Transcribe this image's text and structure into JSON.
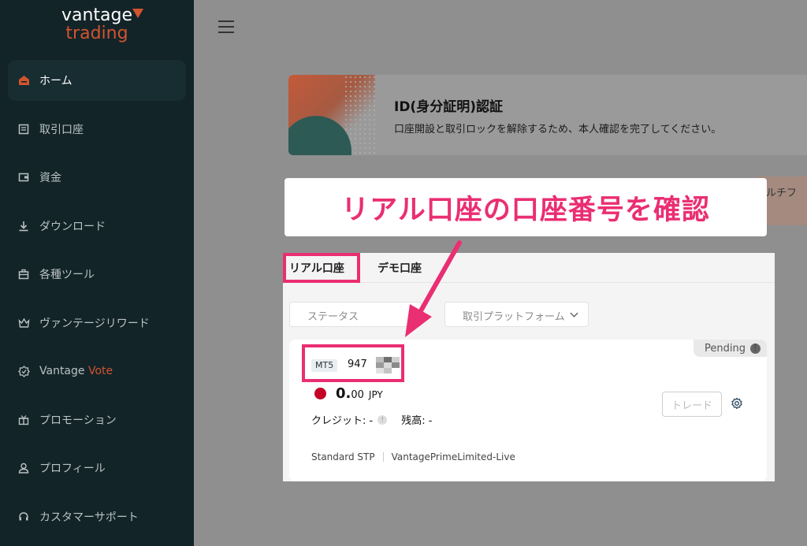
{
  "brand": {
    "line1": "vantage",
    "line2": "trading",
    "accent": "#d1542f"
  },
  "sidebar": {
    "items": [
      {
        "label": "ホーム",
        "icon": "home-icon",
        "active": true
      },
      {
        "label": "取引口座",
        "icon": "document-icon"
      },
      {
        "label": "資金",
        "icon": "wallet-icon"
      },
      {
        "label": "ダウンロード",
        "icon": "download-icon"
      },
      {
        "label": "各種ツール",
        "icon": "toolbox-icon"
      },
      {
        "label": "ヴァンテージリワード",
        "icon": "crown-icon"
      },
      {
        "label": "Vantage ",
        "label_accent": "Vote",
        "icon": "badge-icon"
      },
      {
        "label": "プロモーション",
        "icon": "gift-icon"
      },
      {
        "label": "プロフィール",
        "icon": "user-icon"
      },
      {
        "label": "カスタマーサポート",
        "icon": "headset-icon"
      }
    ]
  },
  "header": {
    "menu_icon": "hamburger-icon"
  },
  "id_verification": {
    "title": "ID(身分証明)認証",
    "description": "口座開設と取引ロックを解除するため、本人確認を完了してください。"
  },
  "promo_peek": {
    "text": "ルチフ"
  },
  "callout": {
    "text": "リアル口座の口座番号を確認",
    "color": "#ea2e72"
  },
  "tabs": [
    {
      "label": "リアル口座",
      "active": true
    },
    {
      "label": "デモ口座"
    }
  ],
  "filters": {
    "status_placeholder": "ステータス",
    "platform_placeholder": "取引プラットフォーム"
  },
  "account": {
    "platform": "MT5",
    "number_prefix": "947",
    "status": "Pending",
    "balance_int": "0.",
    "balance_dec": "00",
    "currency": "JPY",
    "credit_label": "クレジット: -",
    "balance_label": "残高:  -",
    "trade_button": "トレード",
    "account_type": "Standard STP",
    "server": "VantagePrimeLimited-Live"
  }
}
